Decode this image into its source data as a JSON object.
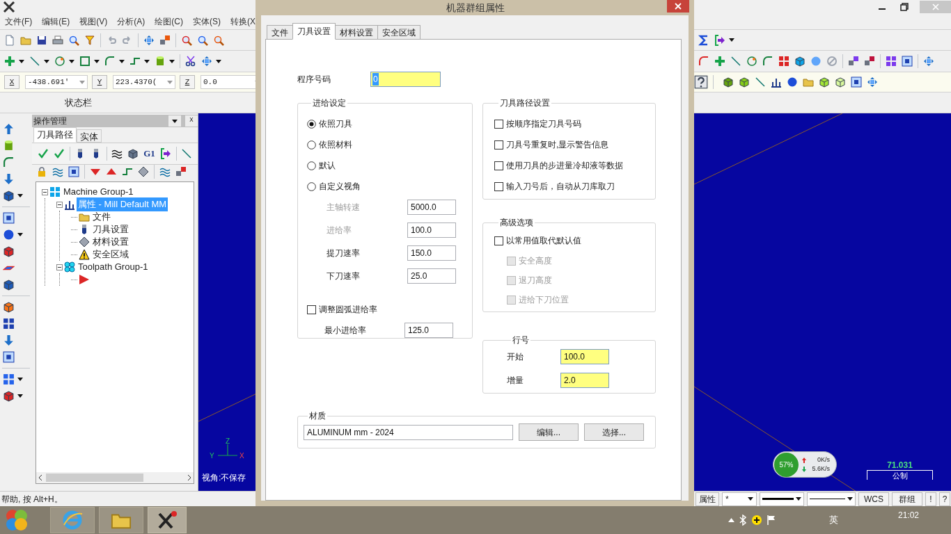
{
  "menu": [
    "文件(F)",
    "编辑(E)",
    "视图(V)",
    "分析(A)",
    "绘图(C)",
    "实体(S)",
    "转换(X"
  ],
  "coords": [
    {
      "axis": "X",
      "value": "-438.691'"
    },
    {
      "axis": "Y",
      "value": "223.4370("
    },
    {
      "axis": "Z",
      "value": "0.0"
    }
  ],
  "status_label": "状态栏",
  "ops_manager": {
    "title": "操作管理",
    "close": "X",
    "gcode_button": "G1",
    "tabs": [
      {
        "label": "刀具路径",
        "selected": true
      },
      {
        "label": "实体",
        "selected": false
      }
    ],
    "tree": [
      {
        "kind": "machine-group",
        "label": "Machine Group-1",
        "selected": false,
        "expanded": true,
        "children": [
          {
            "kind": "properties",
            "label": "属性 - Mill Default MM",
            "selected": true,
            "expanded": true,
            "children": [
              {
                "kind": "files",
                "label": "文件",
                "selected": false
              },
              {
                "kind": "tool-settings",
                "label": "刀具设置",
                "selected": false
              },
              {
                "kind": "stock-settings",
                "label": "材料设置",
                "selected": false
              },
              {
                "kind": "safety-zone",
                "label": "安全区域",
                "selected": false
              }
            ]
          },
          {
            "kind": "toolpath-group",
            "label": "Toolpath Group-1",
            "selected": false,
            "expanded": true,
            "children": [
              {
                "kind": "operation",
                "selected": false
              }
            ]
          }
        ]
      }
    ]
  },
  "viewport": {
    "axis_labels": [
      "Z",
      "Y",
      "X"
    ],
    "view_label": "视角:不保存",
    "net_meter": {
      "percent": "57%",
      "up": "0K/s",
      "down": "5.6K/s"
    },
    "scale": {
      "value": "71.031",
      "unit": "公制"
    }
  },
  "status_bar": {
    "help": "帮助, 按 Alt+H。",
    "attr_button": "属性",
    "point_style": "*",
    "wcs": "WCS",
    "group": "群组",
    "extra": [
      "!",
      "?"
    ]
  },
  "taskbar": {
    "lang": "英",
    "clock": "21:02"
  },
  "dialog": {
    "title": "机器群组属性",
    "tabs": [
      {
        "label": "文件",
        "selected": false
      },
      {
        "label": "刀具设置",
        "selected": true
      },
      {
        "label": "材料设置",
        "selected": false
      },
      {
        "label": "安全区域",
        "selected": false
      }
    ],
    "program_number": {
      "label": "程序号码",
      "value": "0"
    },
    "feed": {
      "title": "进给设定",
      "options": [
        {
          "label": "依照刀具",
          "selected": true
        },
        {
          "label": "依照材料",
          "selected": false
        },
        {
          "label": "默认",
          "selected": false
        },
        {
          "label": "自定义视角",
          "selected": false
        }
      ],
      "rates": [
        {
          "label": "主轴转速",
          "value": "5000.0",
          "disabled": true
        },
        {
          "label": "进给率",
          "value": "100.0",
          "disabled": true
        },
        {
          "label": "提刀速率",
          "value": "150.0",
          "disabled": false
        },
        {
          "label": "下刀速率",
          "value": "25.0",
          "disabled": false
        }
      ],
      "arc_adjust": {
        "label": "调整圆弧进给率",
        "checked": false
      },
      "min_feed": {
        "label": "最小进给率",
        "value": "125.0"
      }
    },
    "toolpath": {
      "title": "刀具路径设置",
      "options": [
        {
          "label": "按顺序指定刀具号码",
          "checked": false
        },
        {
          "label": "刀具号重复时,显示警告信息",
          "checked": false
        },
        {
          "label": "使用刀具的步进量冷却液等数据",
          "checked": false
        },
        {
          "label": "输入刀号后，自动从刀库取刀",
          "checked": false
        }
      ]
    },
    "advanced": {
      "title": "高级选项",
      "main": {
        "label": "以常用值取代默认值",
        "checked": false
      },
      "options": [
        {
          "label": "安全高度",
          "checked": false,
          "disabled": true
        },
        {
          "label": "退刀高度",
          "checked": false,
          "disabled": true
        },
        {
          "label": "进给下刀位置",
          "checked": false,
          "disabled": true
        }
      ]
    },
    "line_numbers": {
      "title": "行号",
      "fields": [
        {
          "label": "开始",
          "value": "100.0"
        },
        {
          "label": "增量",
          "value": "2.0"
        }
      ]
    },
    "material": {
      "title": "材质",
      "value": "ALUMINUM mm - 2024",
      "buttons": [
        "编辑...",
        "选择..."
      ]
    }
  }
}
